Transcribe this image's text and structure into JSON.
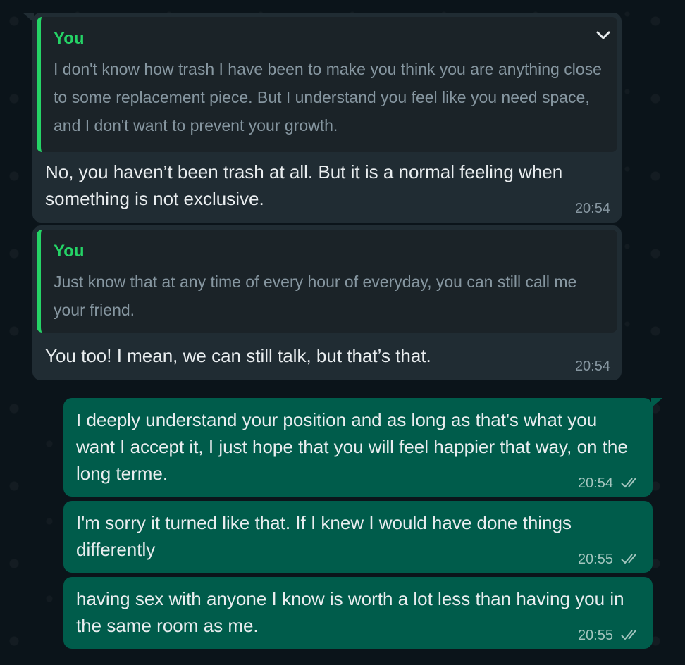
{
  "messages": [
    {
      "direction": "incoming",
      "quote_author": "You",
      "quote_text": "I don't know how trash I have been to make you think you are anything close to some replacement piece. But I understand you feel like you need space, and I don't want to prevent your growth.",
      "text": "No, you haven’t been trash at all. But it is a normal feeling when something is not exclusive.",
      "time": "20:54"
    },
    {
      "direction": "incoming",
      "quote_author": "You",
      "quote_text": "Just know that at any time of every hour of everyday, you can still call me your friend.",
      "text": "You too! I mean, we can still talk, but that’s that.",
      "time": "20:54"
    },
    {
      "direction": "outgoing",
      "text": "I deeply understand your position and as long as that's what you want I accept it, I just hope that you will feel happier that way, on the long terme.",
      "time": "20:54",
      "status": "read"
    },
    {
      "direction": "outgoing",
      "text": "I'm sorry it turned like that. If I knew I would have done things differently",
      "time": "20:55",
      "status": "read"
    },
    {
      "direction": "outgoing",
      "text": "having sex with anyone I know is worth a lot less than having you in the same room as me.",
      "time": "20:55",
      "status": "read"
    }
  ],
  "colors": {
    "background": "#0b141a",
    "incoming_bubble": "#202c33",
    "outgoing_bubble": "#005c4b",
    "quote_accent": "#25d366",
    "read_ticks": "#a4c6bf"
  },
  "icons": {
    "menu": "chevron-down-icon",
    "status": "double-check-icon"
  }
}
